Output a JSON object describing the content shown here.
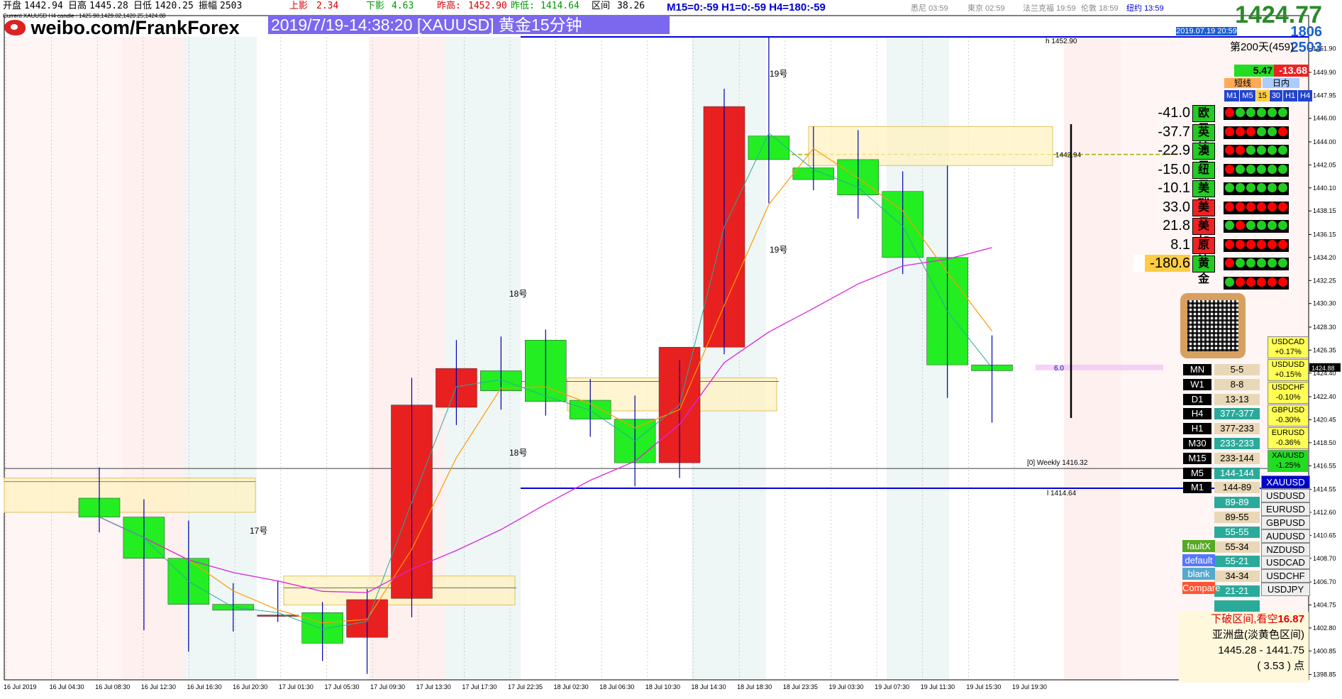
{
  "header": {
    "open_label": "开盘",
    "open": "1442.94",
    "high_label": "日高",
    "high": "1445.28",
    "low_label": "日低",
    "low": "1420.25",
    "range_label": "振幅",
    "range": "2503",
    "upper_shadow_label": "上影",
    "upper_shadow": "2.34",
    "lower_shadow_label": "下影",
    "lower_shadow": "4.63",
    "prev_high_label": "昨高:",
    "prev_high": "1452.90",
    "prev_low_label": "昨低:",
    "prev_low": "1414.64",
    "interval_label": "区间",
    "interval": "38.26",
    "subheader": "Current XAUUSD H4 candle : 1425.98,1429.02,1420.25,1424.88"
  },
  "tf_status": "M15=0:-59  H1=0:-59  H4=180:-59",
  "clocks": [
    {
      "city": "悉尼",
      "time": "03:59"
    },
    {
      "city": "東京",
      "time": "02:59"
    },
    {
      "city": "法兰克福",
      "time": "19:59"
    },
    {
      "city": "伦敦",
      "time": "18:59"
    },
    {
      "city": "纽约",
      "time": "13:59"
    }
  ],
  "brand": "weibo.com/FrankForex",
  "title": "2019/7/19-14:38:20 [XAUUSD] 黄金15分钟",
  "price_big": "1424.77",
  "date_box": "2019.07.19 20:59",
  "num_1806": "1806",
  "num_2503": "2503",
  "day_count": "第200天(459)",
  "pos_val": "5.47",
  "neg_val": "-13.68",
  "mode_tabs": [
    "短线",
    "日内"
  ],
  "tf_tabs": [
    "M1",
    "M5",
    "15",
    "30",
    "H1",
    "H4"
  ],
  "currencies": [
    {
      "val": "-41.0",
      "name": "欧元",
      "color": "#22cc22",
      "dots": [
        "#f00",
        "#2c2",
        "#2c2",
        "#2c2",
        "#2c2",
        "#2c2"
      ]
    },
    {
      "val": "-37.7",
      "name": "英镑",
      "color": "#22cc22",
      "dots": [
        "#f00",
        "#f00",
        "#f00",
        "#2c2",
        "#2c2",
        "#f00"
      ]
    },
    {
      "val": "-22.9",
      "name": "澳元",
      "color": "#22cc22",
      "dots": [
        "#f00",
        "#f00",
        "#2c2",
        "#2c2",
        "#2c2",
        "#2c2"
      ]
    },
    {
      "val": "-15.0",
      "name": "纽元",
      "color": "#22cc22",
      "dots": [
        "#f00",
        "#2c2",
        "#2c2",
        "#2c2",
        "#2c2",
        "#2c2"
      ]
    },
    {
      "val": "-10.1",
      "name": "美瑞",
      "color": "#22cc22",
      "dots": [
        "#2c2",
        "#2c2",
        "#2c2",
        "#2c2",
        "#2c2",
        "#2c2"
      ]
    },
    {
      "val": "33.0",
      "name": "美日",
      "color": "#ee2222",
      "dots": [
        "#f00",
        "#f00",
        "#f00",
        "#f00",
        "#f00",
        "#f00"
      ]
    },
    {
      "val": "21.8",
      "name": "美加",
      "color": "#ee2222",
      "dots": [
        "#2c2",
        "#f00",
        "#2c2",
        "#2c2",
        "#2c2",
        "#2c2"
      ]
    },
    {
      "val": "8.1",
      "name": "原油",
      "color": "#ee2222",
      "dots": [
        "#f00",
        "#f00",
        "#f00",
        "#f00",
        "#f00",
        "#f00"
      ]
    },
    {
      "val": "-180.6",
      "name": "黄金",
      "color": "#22cc22",
      "dots": [
        "#f00",
        "#2c2",
        "#2c2",
        "#2c2",
        "#2c2",
        "#2c2"
      ]
    },
    {
      "val": "",
      "name": "",
      "color": "",
      "dots": [
        "#2c2",
        "#f00",
        "#f00",
        "#f00",
        "#f00",
        "#f00"
      ]
    }
  ],
  "mtf": [
    {
      "tag": "MN",
      "val": "5-5",
      "bg": "#e8d8b8"
    },
    {
      "tag": "W1",
      "val": "8-8",
      "bg": "#e8d8b8"
    },
    {
      "tag": "D1",
      "val": "13-13",
      "bg": "#e8d8b8"
    },
    {
      "tag": "H4",
      "val": "377-377",
      "bg": "#2aaa9a"
    },
    {
      "tag": "H1",
      "val": "377-233",
      "bg": "#e8d8b8"
    },
    {
      "tag": "M30",
      "val": "233-233",
      "bg": "#2aaa9a"
    },
    {
      "tag": "M15",
      "val": "233-144",
      "bg": "#e8d8b8"
    },
    {
      "tag": "M5",
      "val": "144-144",
      "bg": "#2aaa9a"
    },
    {
      "tag": "M1",
      "val": "144-89",
      "bg": "#e8d8b8"
    },
    {
      "tag": "",
      "val": "89-89",
      "bg": "#2aaa9a"
    },
    {
      "tag": "",
      "val": "89-55",
      "bg": "#e8d8b8"
    },
    {
      "tag": "",
      "val": "55-55",
      "bg": "#2aaa9a"
    },
    {
      "tag": "",
      "val": "55-34",
      "bg": "#e8d8b8"
    },
    {
      "tag": "",
      "val": "55-21",
      "bg": "#2aaa9a"
    },
    {
      "tag": "",
      "val": "34-34",
      "bg": "#e8d8b8"
    },
    {
      "tag": "",
      "val": "21-21",
      "bg": "#2aaa9a"
    },
    {
      "tag": "",
      "val": "",
      "bg": "#2aaa9a"
    },
    {
      "tag": "",
      "val": "",
      "bg": "#e8d8b8"
    }
  ],
  "changes": [
    {
      "sym": "USDCAD",
      "chg": "+0.17%"
    },
    {
      "sym": "USDUSD",
      "chg": "+0.15%"
    },
    {
      "sym": "USDCHF",
      "chg": "-0.10%"
    },
    {
      "sym": "GBPUSD",
      "chg": "-0.30%"
    },
    {
      "sym": "EURUSD",
      "chg": "-0.36%"
    },
    {
      "sym": "XAUUSD",
      "chg": "-1.25%"
    }
  ],
  "symbols": [
    "XAUUSD",
    "USDUSD",
    "EURUSD",
    "GBPUSD",
    "AUDUSD",
    "NZDUSD",
    "USDCAD",
    "USDCHF",
    "USDJPY"
  ],
  "side_buttons": [
    {
      "label": "faultX",
      "color": "#55aa22"
    },
    {
      "label": "default",
      "color": "#5577ff"
    },
    {
      "label": "blank",
      "color": "#55aacc"
    },
    {
      "label": "Compare",
      "color": "#ff5533"
    }
  ],
  "info": {
    "line1": "下破区间,看空",
    "line1_val": "16.87",
    "line2": "亚洲盘(淡黄色区间)",
    "line3": "1445.28 - 1441.75",
    "line4": "( 3.53 ) 点"
  },
  "chart_data": {
    "type": "candlestick",
    "symbol": "XAUUSD",
    "timeframe": "M15",
    "ylim": [
      1398.4,
      1452.9
    ],
    "yticks": [
      1451.9,
      1449.9,
      1447.95,
      1446.0,
      1444.0,
      1442.05,
      1440.1,
      1438.15,
      1436.15,
      1434.2,
      1432.25,
      1430.3,
      1428.3,
      1426.35,
      1424.4,
      1422.4,
      1420.45,
      1418.5,
      1416.55,
      1414.55,
      1412.6,
      1410.65,
      1408.7,
      1406.7,
      1404.75,
      1402.8,
      1400.85,
      1398.85
    ],
    "xticks": [
      "16 Jul 2019",
      "16 Jul 04:30",
      "16 Jul 08:30",
      "16 Jul 12:30",
      "16 Jul 16:30",
      "16 Jul 20:30",
      "17 Jul 01:30",
      "17 Jul 05:30",
      "17 Jul 09:30",
      "17 Jul 13:30",
      "17 Jul 17:30",
      "17 Jul 22:35",
      "18 Jul 02:30",
      "18 Jul 06:30",
      "18 Jul 10:30",
      "18 Jul 14:30",
      "18 Jul 18:30",
      "18 Jul 23:35",
      "19 Jul 03:30",
      "19 Jul 07:30",
      "19 Jul 11:30",
      "19 Jul 15:30",
      "19 Jul 19:30"
    ],
    "h4_candles": [
      {
        "o": 1413.8,
        "h": 1416.4,
        "c": 1412.2,
        "l": 1410.9
      },
      {
        "o": 1412.2,
        "h": 1413.7,
        "c": 1408.7,
        "l": 1402.6
      },
      {
        "o": 1408.7,
        "h": 1411.9,
        "c": 1404.8,
        "l": 1400.8
      },
      {
        "o": 1404.8,
        "h": 1406.6,
        "c": 1404.3,
        "l": 1402.5
      },
      {
        "o": 1403.9,
        "h": 1406.8,
        "c": 1403.9,
        "l": 1403.3
      },
      {
        "o": 1404.1,
        "h": 1405.0,
        "c": 1401.5,
        "l": 1400.0
      },
      {
        "o": 1402.0,
        "h": 1406.1,
        "c": 1405.2,
        "l": 1398.9
      },
      {
        "o": 1405.3,
        "h": 1424.0,
        "c": 1421.7,
        "l": 1403.7
      },
      {
        "o": 1421.5,
        "h": 1427.2,
        "c": 1424.8,
        "l": 1420.0
      },
      {
        "o": 1424.6,
        "h": 1427.5,
        "c": 1422.9,
        "l": 1421.3
      },
      {
        "o": 1427.2,
        "h": 1428.1,
        "c": 1422.0,
        "l": 1420.8
      },
      {
        "o": 1422.1,
        "h": 1423.9,
        "c": 1420.5,
        "l": 1419.0
      },
      {
        "o": 1420.5,
        "h": 1422.5,
        "c": 1416.8,
        "l": 1414.8
      },
      {
        "o": 1416.8,
        "h": 1425.5,
        "c": 1426.6,
        "l": 1415.5
      },
      {
        "o": 1426.6,
        "h": 1448.5,
        "c": 1447.0,
        "l": 1426.0
      },
      {
        "o": 1444.5,
        "h": 1452.9,
        "c": 1442.5,
        "l": 1438.8
      },
      {
        "o": 1441.8,
        "h": 1445.3,
        "c": 1440.8,
        "l": 1439.9
      },
      {
        "o": 1442.5,
        "h": 1445.0,
        "c": 1439.5,
        "l": 1437.5
      },
      {
        "o": 1439.8,
        "h": 1441.5,
        "c": 1434.2,
        "l": 1432.8
      },
      {
        "o": 1434.2,
        "h": 1442.0,
        "c": 1425.1,
        "l": 1422.3
      },
      {
        "o": 1425.1,
        "h": 1427.6,
        "c": 1424.6,
        "l": 1420.2
      }
    ],
    "annotations": [
      {
        "text": "19号"
      },
      {
        "text": "19号"
      },
      {
        "text": "18号"
      },
      {
        "text": "18号"
      },
      {
        "text": "17号"
      }
    ],
    "levels": [
      {
        "label": "h 1452.90",
        "value": 1452.9
      },
      {
        "label": "l 1414.64",
        "value": 1414.64
      },
      {
        "label": "[0] Weekly 1416.32",
        "value": 1416.32
      },
      {
        "label": "1442.94",
        "value": 1442.94
      }
    ],
    "current_price": "1424.88",
    "range_marker": "6.0"
  }
}
